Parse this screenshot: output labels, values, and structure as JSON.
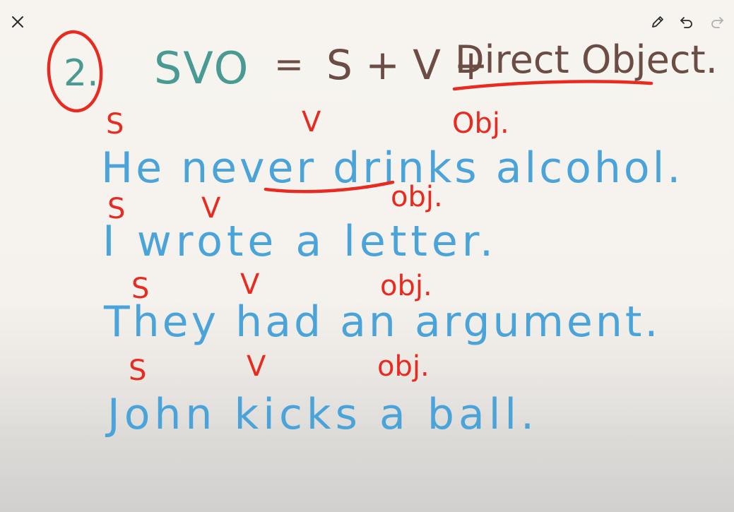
{
  "toolbar": {
    "close_icon": "close-icon",
    "pen_icon": "pencil-icon",
    "undo_icon": "undo-icon",
    "redo_icon": "redo-icon",
    "icon_color": "#2a2a2a",
    "redo_color": "#b0b0b0"
  },
  "heading": {
    "number": "2.",
    "pattern": "SVO",
    "equals": "=",
    "formula": "S + V +",
    "term": "Direct Object."
  },
  "sentences": [
    {
      "text": "He never drinks alcohol.",
      "labels": {
        "s": "S",
        "v": "V",
        "obj": "Obj."
      }
    },
    {
      "text": "I wrote a letter.",
      "labels": {
        "s": "S",
        "v": "V",
        "obj": "obj."
      }
    },
    {
      "text": "They had an argument.",
      "labels": {
        "s": "S",
        "v": "V",
        "obj": "obj."
      }
    },
    {
      "text": "John kicks a ball.",
      "labels": {
        "s": "S",
        "v": "V",
        "obj": "obj."
      }
    }
  ],
  "colors": {
    "teal": "#4a9a94",
    "brown": "#6b4d45",
    "blue": "#4aa4da",
    "red": "#e82a20"
  }
}
